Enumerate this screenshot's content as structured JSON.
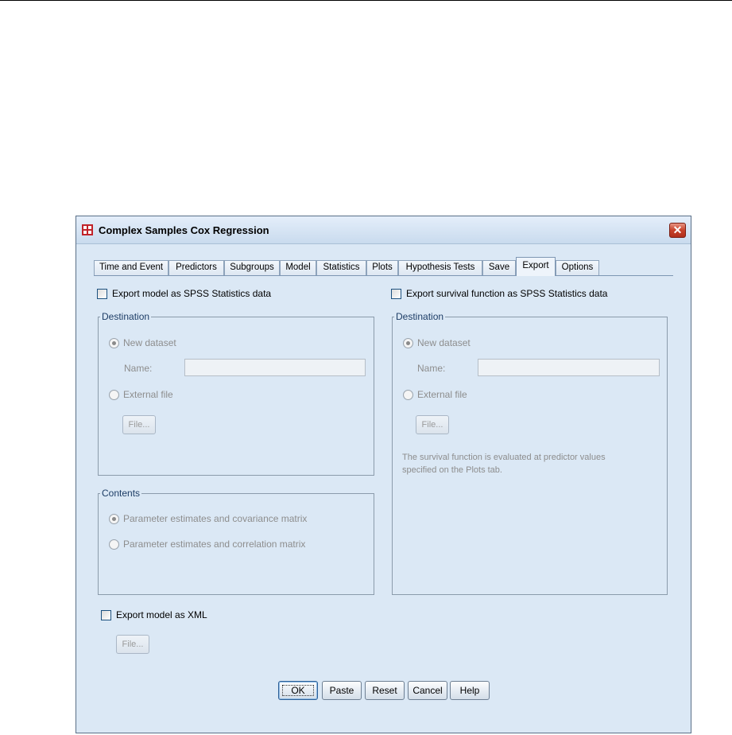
{
  "window": {
    "title": "Complex Samples Cox Regression"
  },
  "tabs": [
    {
      "label": "Time and Event"
    },
    {
      "label": "Predictors"
    },
    {
      "label": "Subgroups"
    },
    {
      "label": "Model"
    },
    {
      "label": "Statistics"
    },
    {
      "label": "Plots"
    },
    {
      "label": "Hypothesis Tests"
    },
    {
      "label": "Save"
    },
    {
      "label": "Export"
    },
    {
      "label": "Options"
    }
  ],
  "active_tab": "Export",
  "left_panel": {
    "checkbox_label": "Export model as SPSS  Statistics data",
    "destination": {
      "title": "Destination",
      "new_dataset": "New dataset",
      "name_label": "Name:",
      "name_value": "",
      "external_file": "External file",
      "file_button": "File..."
    },
    "contents": {
      "title": "Contents",
      "option1": "Parameter estimates and covariance matrix",
      "option2": "Parameter estimates and correlation matrix"
    }
  },
  "right_panel": {
    "checkbox_label": "Export survival function as SPSS  Statistics data",
    "destination": {
      "title": "Destination",
      "new_dataset": "New dataset",
      "name_label": "Name:",
      "name_value": "",
      "external_file": "External file",
      "file_button": "File...",
      "note_line1": "The survival function is evaluated at predictor values",
      "note_line2": "specified on the Plots tab."
    }
  },
  "xml": {
    "checkbox_label": "Export model as XML",
    "file_button": "File..."
  },
  "buttons": {
    "ok": "OK",
    "paste": "Paste",
    "reset": "Reset",
    "cancel": "Cancel",
    "help": "Help"
  }
}
